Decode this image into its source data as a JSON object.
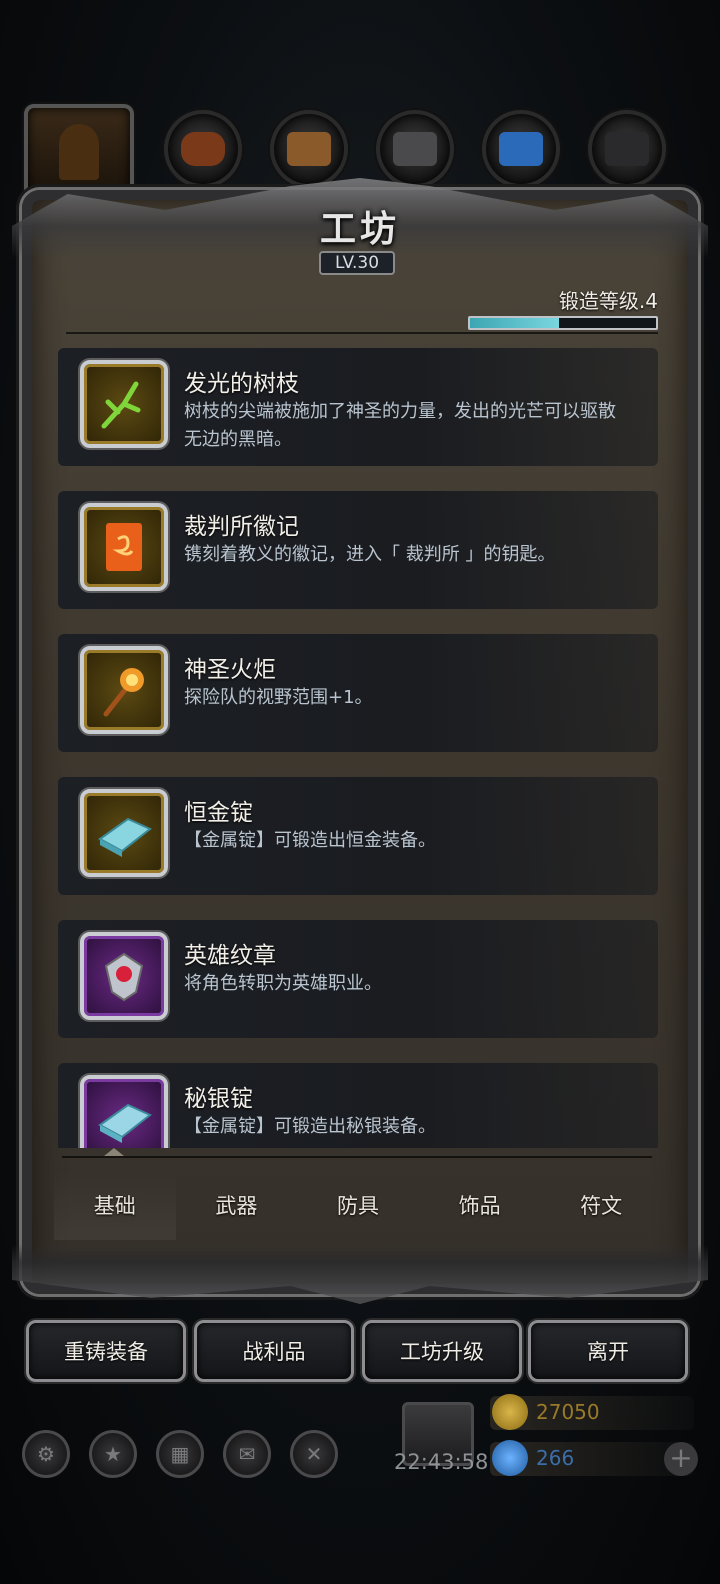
{
  "screen": {
    "title": "工坊",
    "level_badge": "LV.30",
    "forge_level_label": "锻造等级.4",
    "forge_progress": 0.48
  },
  "top_icons": [
    {
      "name": "hood-icon"
    },
    {
      "name": "leather-armor-icon"
    },
    {
      "name": "wood-plank-icon"
    },
    {
      "name": "iron-ingot-icon"
    },
    {
      "name": "blue-crystal-icon"
    },
    {
      "name": "dark-ingot-icon"
    }
  ],
  "items": [
    {
      "name": "发光的树枝",
      "desc": "树枝的尖端被施加了神圣的力量，发出的光芒可以驱散无边的黑暗。",
      "icon": "glowing-branch-icon",
      "frame": "gold"
    },
    {
      "name": "裁判所徽记",
      "desc": "镌刻着教义的徽记，进入「 裁判所 」的钥匙。",
      "icon": "inquisition-emblem-icon",
      "frame": "gold"
    },
    {
      "name": "神圣火炬",
      "desc": "探险队的视野范围+1。",
      "icon": "holy-torch-icon",
      "frame": "gold"
    },
    {
      "name": "恒金锭",
      "desc": "【金属锭】可锻造出恒金装备。",
      "icon": "eternal-gold-ingot-icon",
      "frame": "gold"
    },
    {
      "name": "英雄纹章",
      "desc": "将角色转职为英雄职业。",
      "icon": "hero-crest-icon",
      "frame": "purple"
    },
    {
      "name": "秘银锭",
      "desc": "【金属锭】可锻造出秘银装备。",
      "icon": "mithril-ingot-icon",
      "frame": "purple"
    }
  ],
  "tabs": [
    "基础",
    "武器",
    "防具",
    "饰品",
    "符文"
  ],
  "actions": [
    "重铸装备",
    "战利品",
    "工坊升级",
    "离开"
  ],
  "bottom": {
    "clock": "22:43:58",
    "gold": "27050",
    "gems": "266"
  },
  "colors": {
    "accent_cyan": "#5fc6d0",
    "gold_text": "#9a7a2a",
    "gem_text": "#3b6ea8"
  }
}
